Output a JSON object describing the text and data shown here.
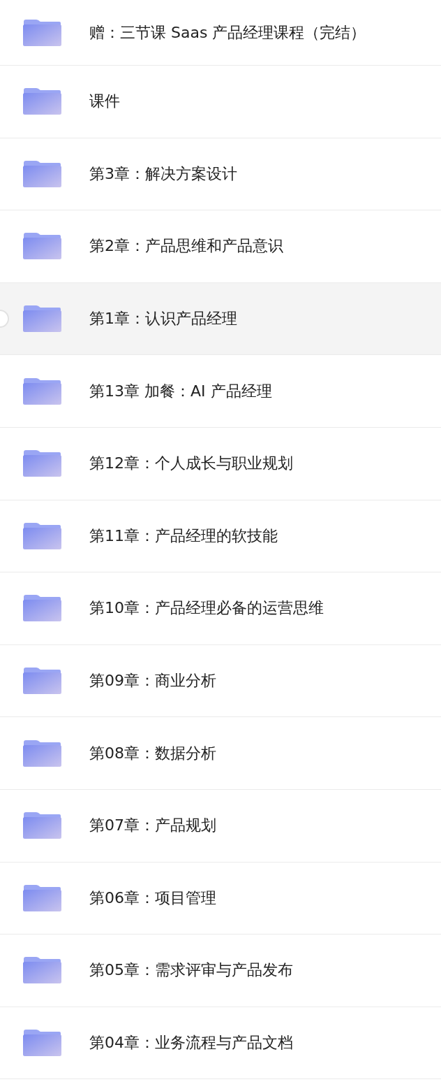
{
  "folders": [
    {
      "name": "赠：三节课 Saas 产品经理课程（完结）",
      "selected": false
    },
    {
      "name": "课件",
      "selected": false
    },
    {
      "name": "第3章：解决方案设计",
      "selected": false
    },
    {
      "name": "第2章：产品思维和产品意识",
      "selected": false
    },
    {
      "name": "第1章：认识产品经理",
      "selected": true
    },
    {
      "name": "第13章 加餐：AI 产品经理",
      "selected": false
    },
    {
      "name": "第12章：个人成长与职业规划",
      "selected": false
    },
    {
      "name": "第11章：产品经理的软技能",
      "selected": false
    },
    {
      "name": "第10章：产品经理必备的运营思维",
      "selected": false
    },
    {
      "name": "第09章：商业分析",
      "selected": false
    },
    {
      "name": "第08章：数据分析",
      "selected": false
    },
    {
      "name": "第07章：产品规划",
      "selected": false
    },
    {
      "name": "第06章：项目管理",
      "selected": false
    },
    {
      "name": "第05章：需求评审与产品发布",
      "selected": false
    },
    {
      "name": "第04章：业务流程与产品文档",
      "selected": false
    }
  ]
}
